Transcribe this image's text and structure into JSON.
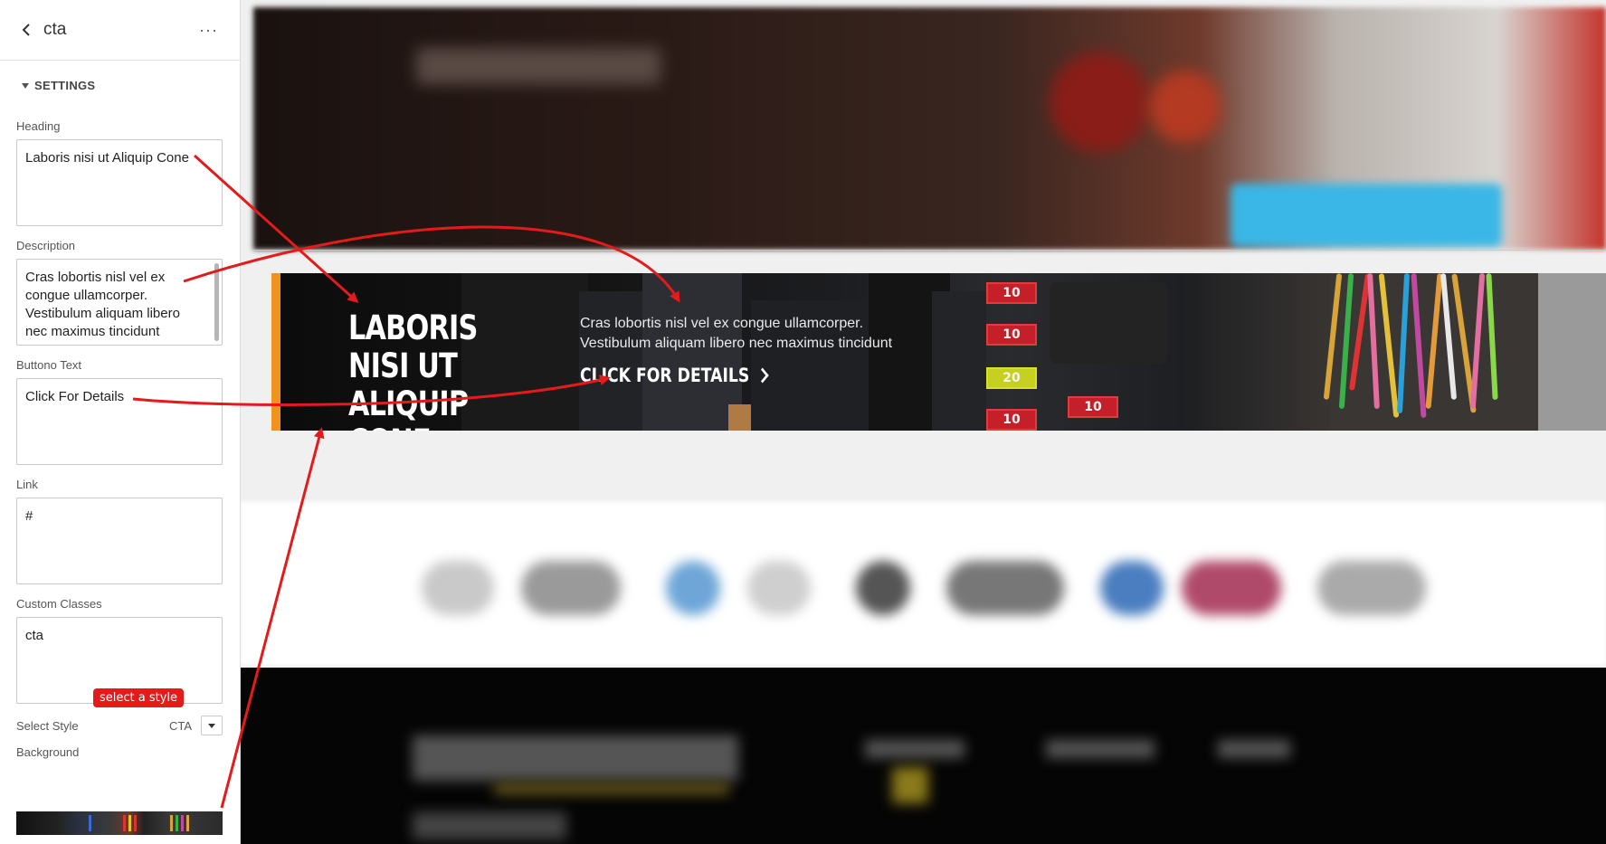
{
  "panel": {
    "title": "cta",
    "section": "SETTINGS",
    "heading_label": "Heading",
    "heading_value": "Laboris nisi ut Aliquip Cone",
    "description_label": "Description",
    "description_value": "Cras lobortis nisl vel ex congue ullamcorper. Vestibulum aliquam libero nec maximus tincidunt",
    "button_text_label": "Buttono Text",
    "button_text_value": "Click For Details",
    "link_label": "Link",
    "link_value": "#",
    "custom_classes_label": "Custom Classes",
    "custom_classes_value": "cta",
    "select_style_label": "Select Style",
    "select_style_value": "CTA",
    "background_label": "Background"
  },
  "callout": {
    "text": "select a style"
  },
  "cta_preview": {
    "heading": "Laboris nisi ut Aliquip Cone",
    "description": "Cras lobortis nisl vel ex congue ullamcorper. Vestibulum aliquam libero nec maximus tincidunt",
    "button": "Click For Details",
    "fuse_labels": [
      "10",
      "10",
      "20",
      "10",
      "10"
    ]
  },
  "colors": {
    "accent": "#f0921e",
    "annotation": "#e31b1b",
    "fuse_red": "#c5202a",
    "fuse_yellow": "#c6d021"
  },
  "icons": [
    "back-chevron-icon",
    "more-options-icon",
    "collapse-triangle-icon",
    "dropdown-caret-icon",
    "chevron-right-icon"
  ]
}
